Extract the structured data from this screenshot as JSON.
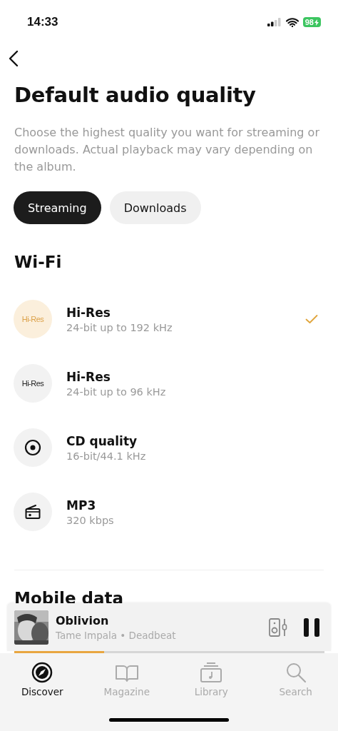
{
  "status_bar": {
    "time": "14:33",
    "battery": "98"
  },
  "title": "Default audio quality",
  "description": "Choose the highest quality you want for streaming or downloads. Actual playback may vary depending on the album.",
  "tabs": [
    {
      "label": "Streaming",
      "selected": true
    },
    {
      "label": "Downloads",
      "selected": false
    }
  ],
  "sections": [
    {
      "heading": "Wi-Fi",
      "options": [
        {
          "kind": "hires",
          "badge": "Hi-Res",
          "title": "Hi-Res",
          "detail": "24-bit up to 192 kHz",
          "selected": true
        },
        {
          "kind": "hires",
          "badge": "Hi-Res",
          "title": "Hi-Res",
          "detail": "24-bit up to 96 kHz",
          "selected": false
        },
        {
          "kind": "disc",
          "title": "CD quality",
          "detail": "16-bit/44.1 kHz",
          "selected": false
        },
        {
          "kind": "radio",
          "title": "MP3",
          "detail": "320 kbps",
          "selected": false
        }
      ]
    },
    {
      "heading": "Mobile data"
    }
  ],
  "player": {
    "track": "Oblivion",
    "subtitle": "Tame Impala • Deadbeat",
    "level": 0.29,
    "playing": true
  },
  "nav": [
    {
      "kind": "compass",
      "label": "Discover",
      "selected": true
    },
    {
      "kind": "book",
      "label": "Magazine",
      "selected": false
    },
    {
      "kind": "library",
      "label": "Library",
      "selected": false
    },
    {
      "kind": "search",
      "label": "Search",
      "selected": false
    }
  ]
}
